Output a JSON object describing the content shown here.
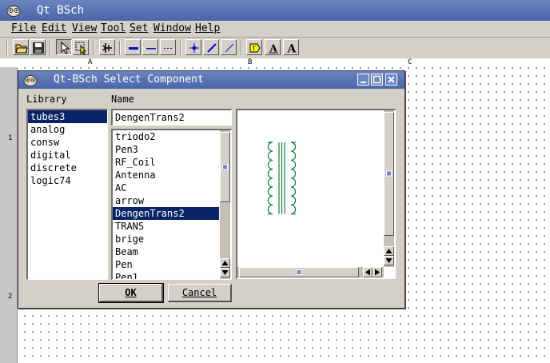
{
  "app": {
    "title": "Qt BSch"
  },
  "menu": [
    "File",
    "Edit",
    "View",
    "Tool",
    "Set",
    "Window",
    "Help"
  ],
  "ruler": {
    "cols": [
      "A",
      "B",
      "C"
    ],
    "rows": [
      "1",
      "2"
    ]
  },
  "toolbar": {
    "icons": [
      "open-folder-icon",
      "save-icon",
      "select-arrow-icon",
      "drag-select-icon",
      "component-icon",
      "bus-line-icon",
      "wire-line-icon",
      "dashed-line-icon",
      "junction-icon",
      "wire-draw-icon",
      "entry-line-icon",
      "tag-icon",
      "label-icon",
      "comment-text-icon"
    ],
    "label_glyph": "A",
    "comment_glyph": "A"
  },
  "dialog": {
    "title": "Qt-BSch Select Component",
    "library_label": "Library",
    "name_label": "Name",
    "name_value": "DengenTrans2",
    "libraries": [
      "tubes3",
      "analog",
      "consw",
      "digital",
      "discrete",
      "logic74"
    ],
    "selected_library": "tubes3",
    "components": [
      "triodo2",
      "Pen3",
      "RF_Coil",
      "Antenna",
      "AC",
      "arrow",
      "DengenTrans2",
      "TRANS",
      "brige",
      "Beam",
      "Pen",
      "Pen1"
    ],
    "selected_component": "DengenTrans2",
    "ok_label": "OK",
    "cancel_label": "Cancel",
    "symbol_color": "#1a7a3a",
    "selection_color": "#0a246a"
  }
}
